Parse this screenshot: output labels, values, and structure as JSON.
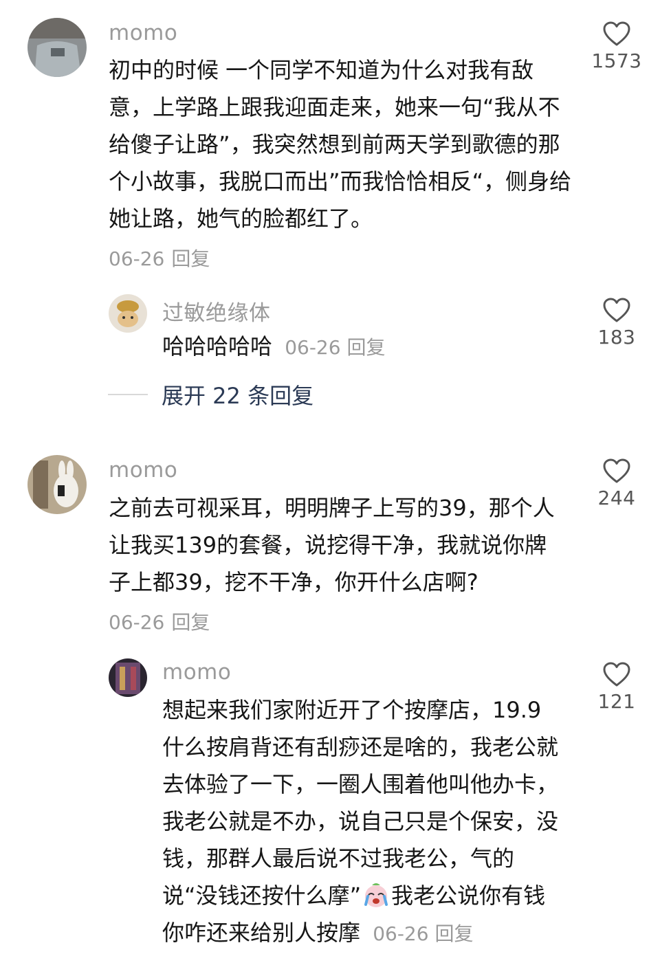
{
  "comments": [
    {
      "username": "momo",
      "text": "初中的时候 一个同学不知道为什么对我有敌意，上学路上跟我迎面走来，她来一句“我从不给傻子让路”，我突然想到前两天学到歌德的那个小故事，我脱口而出”而我恰恰相反“，侧身给她让路，她气的脸都红了。",
      "date": "06-26",
      "reply_label": "回复",
      "likes": "1573",
      "avatar_icon": "avatar-photo-icon"
    },
    {
      "username": "过敏绝缘体",
      "text": "哈哈哈哈哈",
      "date": "06-26",
      "reply_label": "回复",
      "likes": "183",
      "avatar_icon": "avatar-photo-icon"
    },
    {
      "username": "momo",
      "text": "之前去可视采耳，明明牌子上写的39，那个人让我买139的套餐，说挖得干净，我就说你牌子上都39，挖不干净，你开什么店啊?",
      "date": "06-26",
      "reply_label": "回复",
      "likes": "244",
      "avatar_icon": "avatar-photo-icon"
    },
    {
      "username": "momo",
      "text_before_emoji": "想起来我们家附近开了个按摩店，19.9什么按肩背还有刮痧还是啥的，我老公就去体验了一下，一圈人围着他叫他办卡，我老公就是不办，说自己只是个保安，没钱，那群人最后说不过我老公，气的说“没钱还按什么摩”",
      "text_after_emoji": "我老公说你有钱你咋还来给别人按摩",
      "emoji_icon": "crying-face-emoji-icon",
      "date": "06-26",
      "reply_label": "回复",
      "likes": "121",
      "avatar_icon": "avatar-photo-icon"
    }
  ],
  "expand_replies": "展开 22 条回复",
  "colors": {
    "text": "#161616",
    "meta": "#9a9a9a",
    "expand": "#2b3a55"
  }
}
